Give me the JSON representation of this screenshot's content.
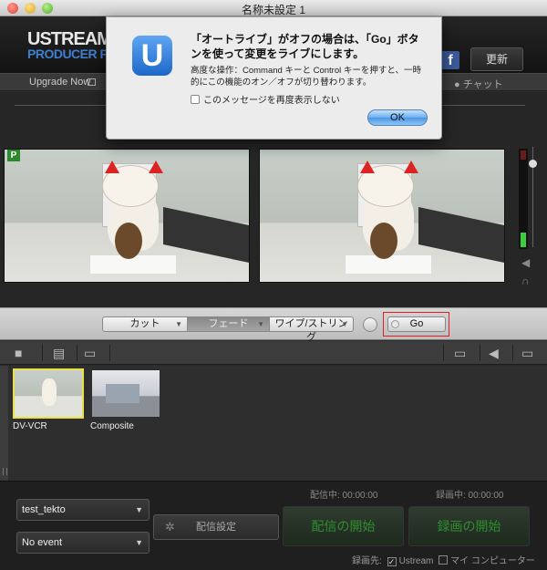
{
  "window": {
    "title": "名称未設定 1"
  },
  "header": {
    "logo_line1": "USTREAM",
    "logo_line2": "PRODUCER PRO",
    "facebook_glyph": "f",
    "update_label": "更新"
  },
  "subnav": {
    "upgrade_label": "Upgrade Now",
    "chat_label": "チャット"
  },
  "preview": {
    "program_badge": "P"
  },
  "transitions": {
    "cut_label": "カット",
    "fade_label": "フェード",
    "wipe_label": "ワイプ/ストリング",
    "go_label": "Go",
    "selected": "フェード"
  },
  "sources": [
    {
      "label": "DV-VCR",
      "selected": true
    },
    {
      "label": "Composite",
      "selected": false
    }
  ],
  "bottom": {
    "broadcast_status": "配信中: 00:00:00",
    "record_status": "録画中: 00:00:00",
    "account_value": "test_tekto",
    "event_value": "No event",
    "settings_label": "配信設定",
    "start_broadcast_label": "配信の開始",
    "start_record_label": "録画の開始",
    "destination_label": "録画先:",
    "dest_ustream_label": "Ustream",
    "dest_ustream_checked": "✓",
    "dest_computer_label": "マイ コンピューター"
  },
  "dialog": {
    "app_icon_letter": "U",
    "title": "「オートライブ」がオフの場合は、「Go」ボタンを使って変更をライブにします。",
    "body": "高度な操作：Command キーと Control キーを押すと、一時的にこの機能のオン／オフが切り替わります。",
    "checkbox_label": "このメッセージを再度表示しない",
    "ok_label": "OK"
  },
  "icons": {
    "chevron": "▼",
    "camera": "■",
    "document": "▤",
    "monitor": "▭",
    "speaker": "◀",
    "headphones": "∩",
    "gear": "✲",
    "chat": "●"
  }
}
